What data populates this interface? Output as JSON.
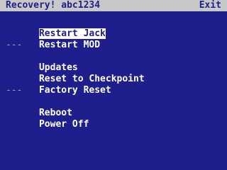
{
  "header": {
    "title": "Recovery! abc1234",
    "exit_label": "Exit",
    "exit_icon": "music-note-icon"
  },
  "menu": {
    "items": [
      {
        "label": "Restart Jack",
        "selected": true
      },
      {
        "label": "Restart MOD"
      },
      {
        "separator": "---"
      },
      {
        "label": "Updates"
      },
      {
        "label": "Reset to Checkpoint"
      },
      {
        "label": "Factory Reset"
      },
      {
        "separator": "---"
      },
      {
        "label": "Reboot"
      },
      {
        "label": "Power Off"
      }
    ]
  },
  "colors": {
    "background": "#1e1e8c",
    "titlebar": "#c8c8c8",
    "text": "#ffffff",
    "separator": "#aaaaaa"
  }
}
